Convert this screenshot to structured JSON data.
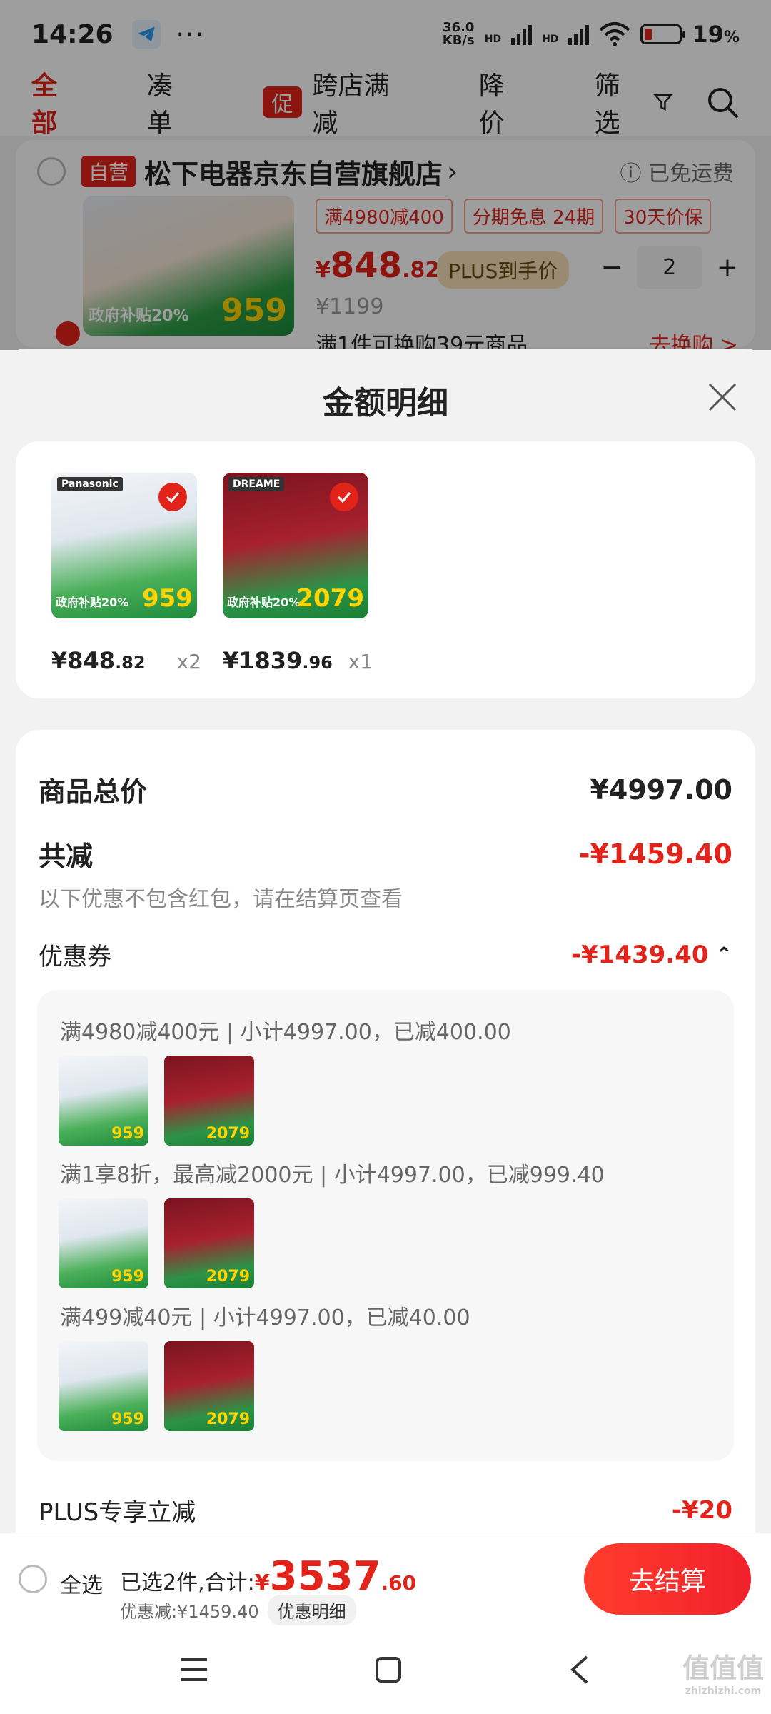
{
  "status_bar": {
    "time": "14:26",
    "net_speed_value": "36.0",
    "net_speed_unit": "KB/s",
    "hd1": "HD",
    "hd2": "HD",
    "battery": "19",
    "battery_unit": "%"
  },
  "filter_tabs": {
    "all": "全部",
    "bundle": "凑单",
    "promo_tag": "促",
    "cross_store": "跨店满减",
    "price_drop": "降价",
    "filter": "筛选"
  },
  "cart_item": {
    "self_operated": "自营",
    "shop_name": "松下电器京东自营旗舰店",
    "free_shipping": "已免运费",
    "tags": [
      "满4980减400",
      "分期免息 24期",
      "30天价保"
    ],
    "price_yen": "¥",
    "price_int": "848",
    "price_dec": ".82",
    "plus_tag": "PLUS到手价",
    "qty": "2",
    "original_price": "¥1199",
    "swap_text": "满1件可换购39元商品",
    "swap_link": "去换购 >",
    "thumb_price": "959",
    "thumb_banner": "政府补贴20%"
  },
  "sheet": {
    "title": "金额明细",
    "products": [
      {
        "brand": "Panasonic",
        "thumb_price": "959",
        "gov": "政府补贴20%",
        "price_yen": "¥",
        "price_int": "848",
        "price_dec": ".82",
        "qty": "x2"
      },
      {
        "brand": "DREAME",
        "thumb_price": "2079",
        "gov": "政府补贴20%",
        "price_yen": "¥",
        "price_int": "1839",
        "price_dec": ".96",
        "qty": "x1"
      }
    ],
    "total_label": "商品总价",
    "total_value": "¥4997.00",
    "reduce_label": "共减",
    "reduce_value": "-¥1459.40",
    "reduce_note": "以下优惠不包含红包，请在结算页查看",
    "coupon_label": "优惠券",
    "coupon_value": "-¥1439.40",
    "coupon_lines": [
      "满4980减400元 | 小计4997.00，已减400.00",
      "满1享8折，最高减2000元 | 小计4997.00，已减999.40",
      "满499减40元 | 小计4997.00，已减40.00"
    ],
    "mini_prices": [
      "959",
      "2079"
    ],
    "plus_label": "PLUS专享立减",
    "plus_value": "-¥20"
  },
  "bottom_bar": {
    "select_all": "全选",
    "selected_text": "已选2件,合计:",
    "total_yen": "¥",
    "total_int": "3537",
    "total_dec": ".60",
    "discount_text": "优惠减:¥1459.40",
    "discount_detail_btn": "优惠明细",
    "checkout": "去结算"
  },
  "watermark": {
    "main": "值值值",
    "sub": "zhizhizhi.com"
  },
  "colors": {
    "accent": "#e2231a",
    "plus_gold": "#f7e0b8"
  }
}
